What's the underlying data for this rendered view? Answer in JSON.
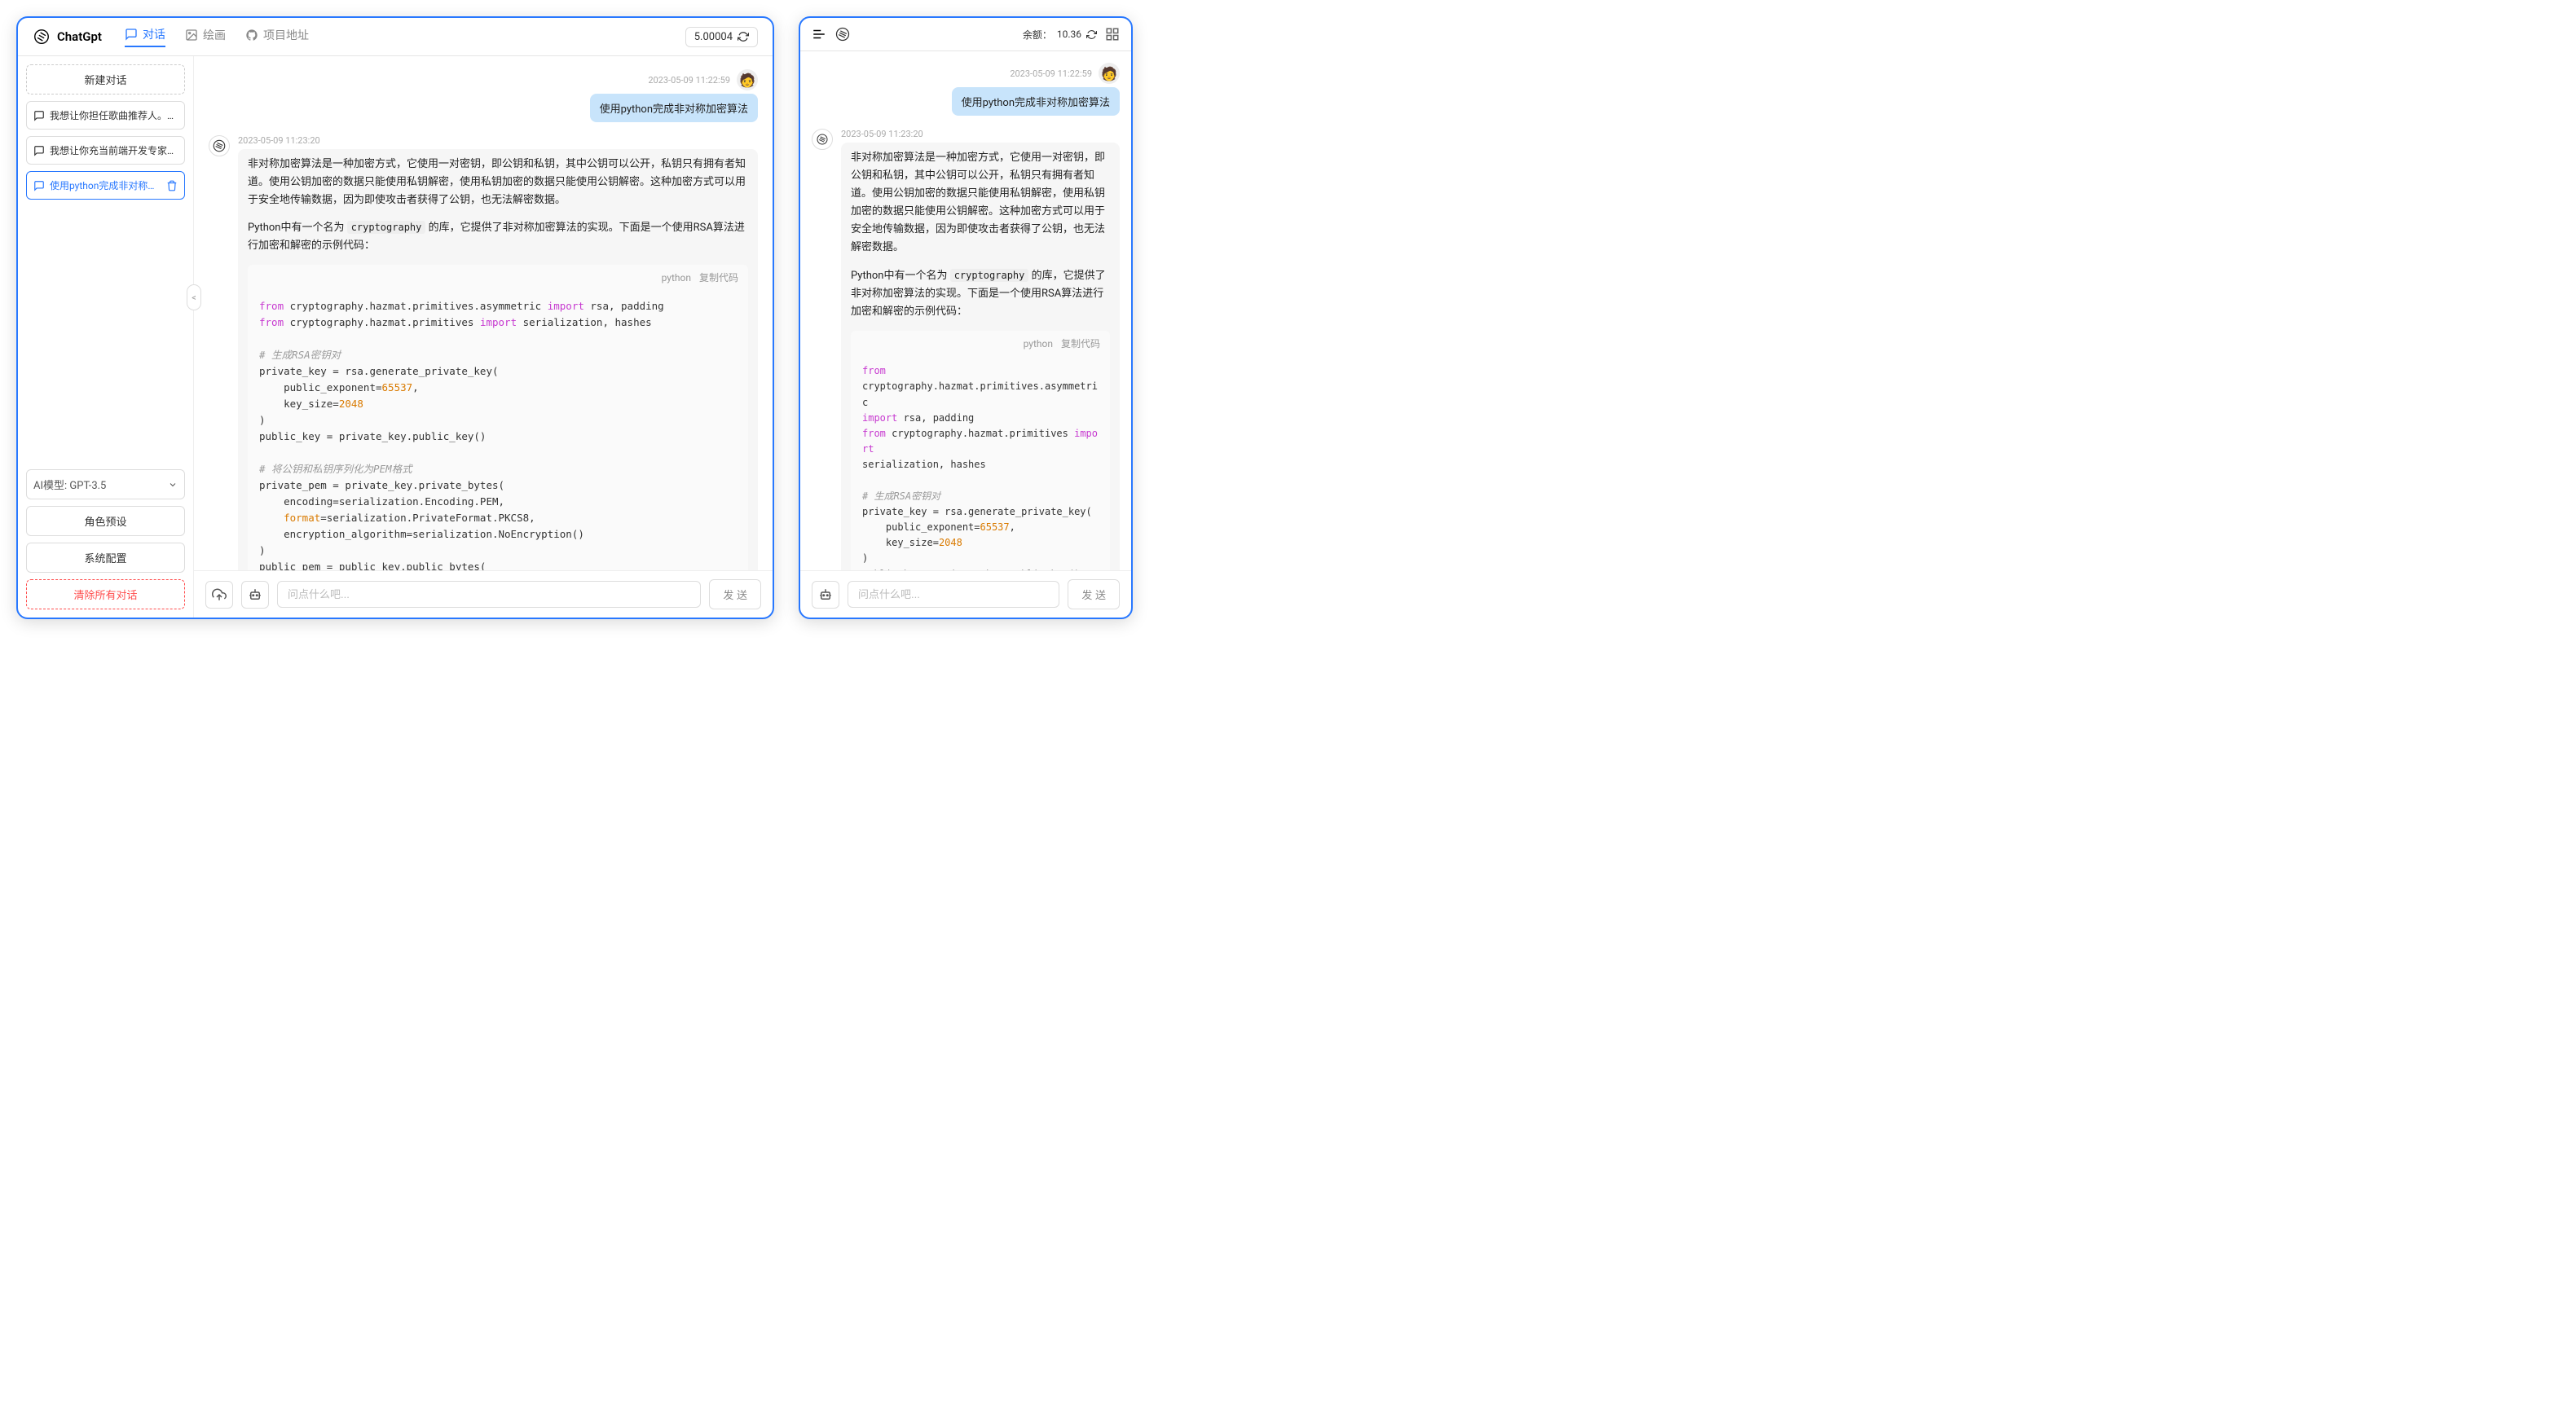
{
  "app": {
    "title": "ChatGpt",
    "tabs": [
      {
        "label": "对话",
        "active": true
      },
      {
        "label": "绘画",
        "active": false
      },
      {
        "label": "项目地址",
        "active": false
      }
    ],
    "balance_value": "5.00004"
  },
  "sidebar": {
    "new_chat": "新建对话",
    "items": [
      {
        "label": "我想让你担任歌曲推荐人。我将为...",
        "active": false
      },
      {
        "label": "我想让你充当前端开发专家。我将...",
        "active": false
      },
      {
        "label": "使用python完成非对称加密算法",
        "active": true
      }
    ],
    "model_label": "AI模型: GPT-3.5",
    "role_preset": "角色预设",
    "sys_config": "系统配置",
    "clear_all": "清除所有对话"
  },
  "chat": {
    "user_msg": {
      "time": "2023-05-09 11:22:59",
      "text": "使用python完成非对称加密算法"
    },
    "ai_msg": {
      "time": "2023-05-09 11:23:20",
      "p1": "非对称加密算法是一种加密方式，它使用一对密钥，即公钥和私钥，其中公钥可以公开，私钥只有拥有者知道。使用公钥加密的数据只能使用私钥解密，使用私钥加密的数据只能使用公钥解密。这种加密方式可以用于安全地传输数据，因为即使攻击者获得了公钥，也无法解密数据。",
      "p2_pre": "Python中有一个名为 ",
      "p2_code": "cryptography",
      "p2_post": " 的库，它提供了非对称加密算法的实现。下面是一个使用RSA算法进行加密和解密的示例代码：",
      "code": {
        "lang": "python",
        "copy": "复制代码"
      }
    },
    "input_placeholder": "问点什么吧...",
    "send": "发 送"
  },
  "right": {
    "balance_label": "余额：",
    "balance_value": "10.36"
  }
}
